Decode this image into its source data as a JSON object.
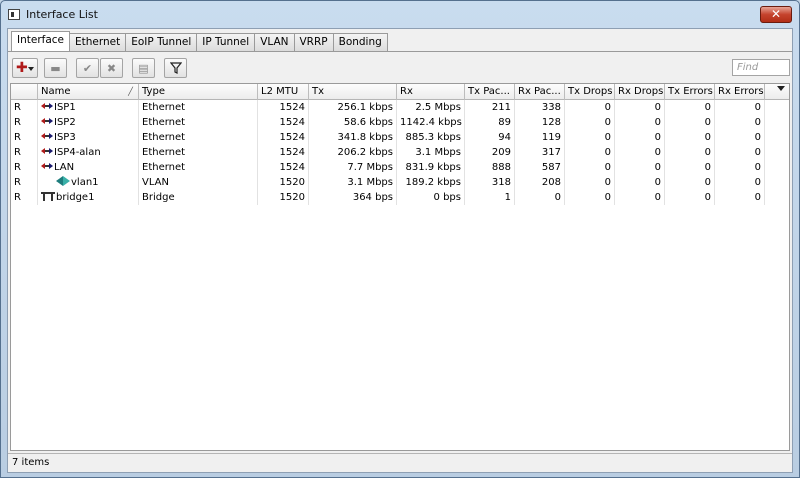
{
  "window": {
    "title": "Interface List",
    "close_label": "✕"
  },
  "tabs": [
    "Interface",
    "Ethernet",
    "EoIP Tunnel",
    "IP Tunnel",
    "VLAN",
    "VRRP",
    "Bonding"
  ],
  "toolbar": {
    "find_placeholder": "Find"
  },
  "table": {
    "headers": {
      "flag": "",
      "name": "Name",
      "type": "Type",
      "l2mtu": "L2 MTU",
      "tx": "Tx",
      "rx": "Rx",
      "txp": "Tx Pac...",
      "rxp": "Rx Pac...",
      "txd": "Tx Drops",
      "rxd": "Rx Drops",
      "txe": "Tx Errors",
      "rxe": "Rx Errors"
    },
    "rows": [
      {
        "flag": "R",
        "icon": "ethernet-icon",
        "name": "ISP1",
        "type": "Ethernet",
        "l2mtu": "1524",
        "tx": "256.1 kbps",
        "rx": "2.5 Mbps",
        "txp": "211",
        "rxp": "338",
        "txd": "0",
        "rxd": "0",
        "txe": "0",
        "rxe": "0"
      },
      {
        "flag": "R",
        "icon": "ethernet-icon",
        "name": "ISP2",
        "type": "Ethernet",
        "l2mtu": "1524",
        "tx": "58.6 kbps",
        "rx": "1142.4 kbps",
        "txp": "89",
        "rxp": "128",
        "txd": "0",
        "rxd": "0",
        "txe": "0",
        "rxe": "0"
      },
      {
        "flag": "R",
        "icon": "ethernet-icon",
        "name": "ISP3",
        "type": "Ethernet",
        "l2mtu": "1524",
        "tx": "341.8 kbps",
        "rx": "885.3 kbps",
        "txp": "94",
        "rxp": "119",
        "txd": "0",
        "rxd": "0",
        "txe": "0",
        "rxe": "0"
      },
      {
        "flag": "R",
        "icon": "ethernet-icon",
        "name": "ISP4-alan",
        "type": "Ethernet",
        "l2mtu": "1524",
        "tx": "206.2 kbps",
        "rx": "3.1 Mbps",
        "txp": "209",
        "rxp": "317",
        "txd": "0",
        "rxd": "0",
        "txe": "0",
        "rxe": "0"
      },
      {
        "flag": "R",
        "icon": "ethernet-icon",
        "name": "LAN",
        "type": "Ethernet",
        "l2mtu": "1524",
        "tx": "7.7 Mbps",
        "rx": "831.9 kbps",
        "txp": "888",
        "rxp": "587",
        "txd": "0",
        "rxd": "0",
        "txe": "0",
        "rxe": "0"
      },
      {
        "flag": "R",
        "icon": "vlan-icon",
        "name": "vlan1",
        "type": "VLAN",
        "l2mtu": "1520",
        "tx": "3.1 Mbps",
        "rx": "189.2 kbps",
        "txp": "318",
        "rxp": "208",
        "txd": "0",
        "rxd": "0",
        "txe": "0",
        "rxe": "0"
      },
      {
        "flag": "R",
        "icon": "bridge-icon",
        "name": "bridge1",
        "type": "Bridge",
        "l2mtu": "1520",
        "tx": "364 bps",
        "rx": "0 bps",
        "txp": "1",
        "rxp": "0",
        "txd": "0",
        "rxd": "0",
        "txe": "0",
        "rxe": "0"
      }
    ]
  },
  "status": {
    "count_text": "7 items"
  }
}
